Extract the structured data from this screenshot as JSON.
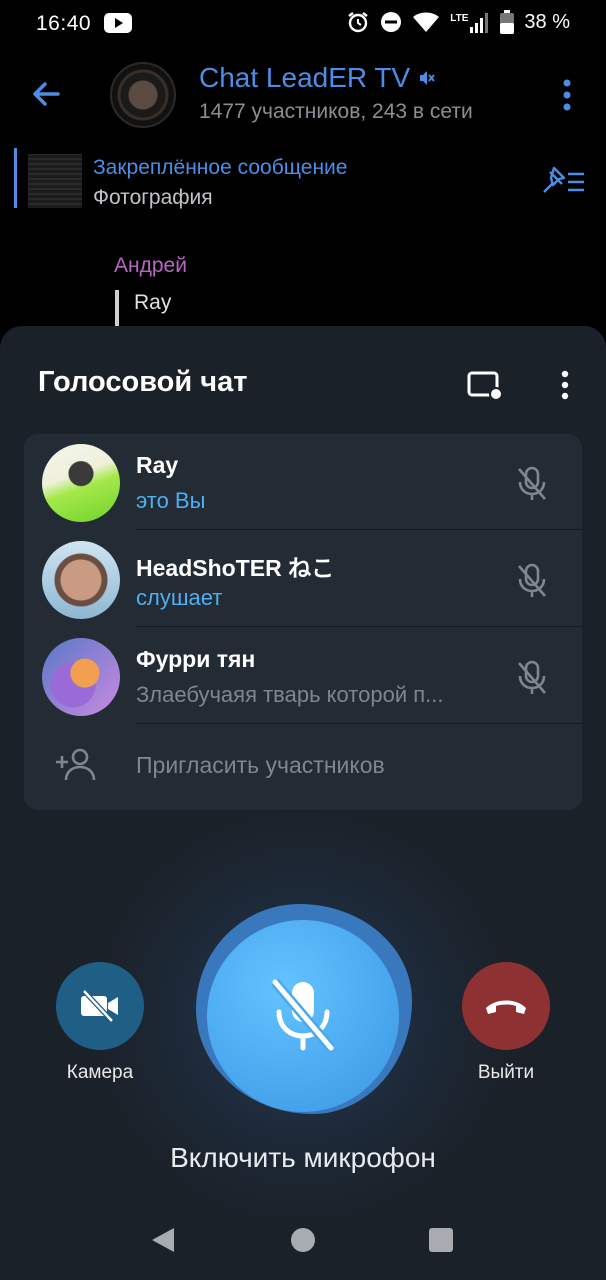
{
  "status_bar": {
    "time": "16:40",
    "network": "LTE",
    "battery": "38 %"
  },
  "chat": {
    "title": "Chat LeadER TV",
    "subtitle": "1477 участников, 243 в сети",
    "pinned": {
      "title": "Закреплённое сообщение",
      "text": "Фотография"
    },
    "message": {
      "author": "Андрей",
      "reply_to": "Ray"
    }
  },
  "voice_chat": {
    "title": "Голосовой чат",
    "participants": [
      {
        "name": "Ray",
        "status": "это Вы",
        "status_color": "#4db0f2",
        "mic": "mic-muted-icon"
      },
      {
        "name": "HeadShoTER ねこ",
        "status": "слушает",
        "status_color": "#4db0f2",
        "mic": "mic-muted-icon"
      },
      {
        "name": "Фурри тян",
        "status": "Злаебучаяя тварь которой п...",
        "status_color": "#7d8691",
        "mic": "mic-muted-icon"
      }
    ],
    "invite_label": "Пригласить участников",
    "camera_label": "Камера",
    "leave_label": "Выйти",
    "mic_label": "Включить микрофон"
  },
  "colors": {
    "accent": "#4c8ee6",
    "sheet_bg": "#1b2129",
    "card_bg": "#232b35",
    "mic_button": "#4aa8ef",
    "leave_button": "#8d3133",
    "camera_button": "#1f5f86"
  }
}
